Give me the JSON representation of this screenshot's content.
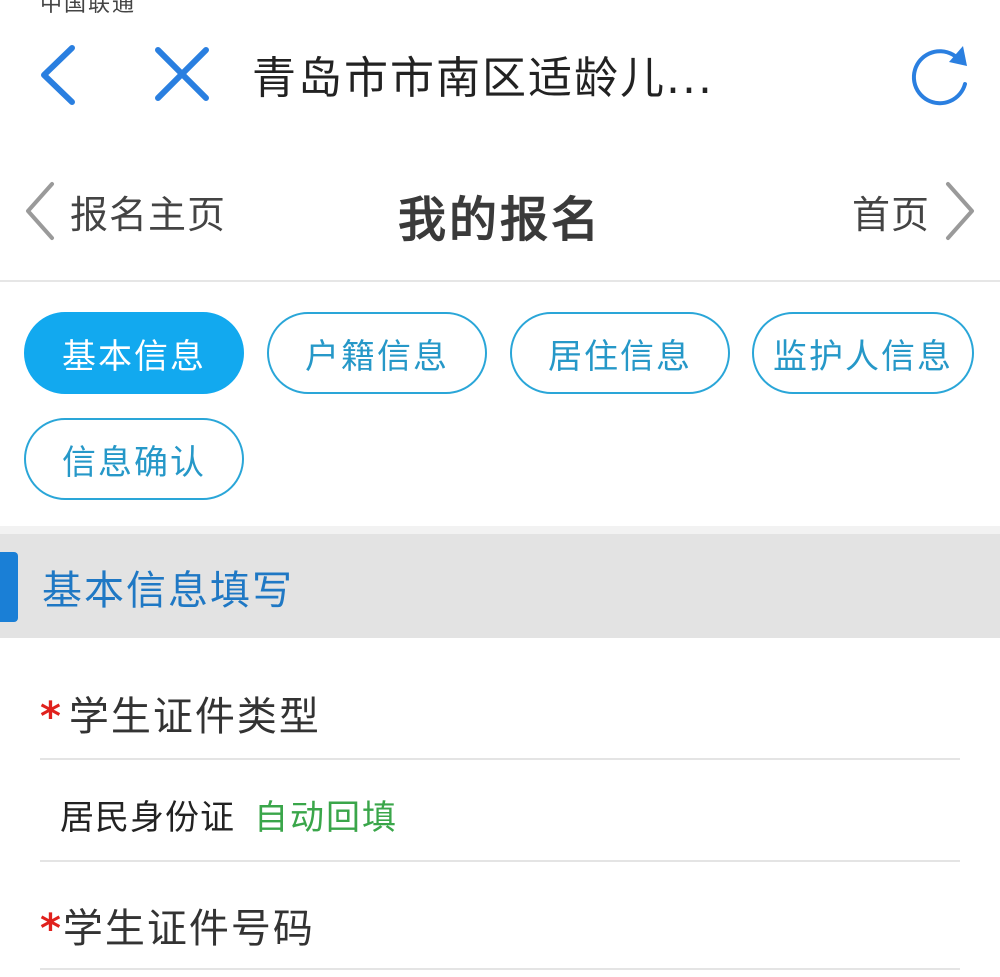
{
  "status_bar": {
    "fragment": "中国联通"
  },
  "browser": {
    "title": "青岛市市南区适龄儿..."
  },
  "page_nav": {
    "left_label": "报名主页",
    "title": "我的报名",
    "right_label": "首页"
  },
  "tabs": [
    {
      "label": "基本信息",
      "active": true
    },
    {
      "label": "户籍信息",
      "active": false
    },
    {
      "label": "居住信息",
      "active": false
    },
    {
      "label": "监护人信息",
      "active": false
    },
    {
      "label": "信息确认",
      "active": false
    }
  ],
  "section": {
    "title": "基本信息填写"
  },
  "form": {
    "doc_type_label": "学生证件类型",
    "doc_type_value": "居民身份证",
    "auto_fill": "自动回填",
    "doc_number_label": "学生证件号码",
    "required_mark": "*"
  },
  "colors": {
    "accent_blue": "#12a9ef",
    "link_blue": "#2a7fe0",
    "section_title": "#1f78c4",
    "required_red": "#e0211d",
    "auto_fill_green": "#3aa64a"
  }
}
